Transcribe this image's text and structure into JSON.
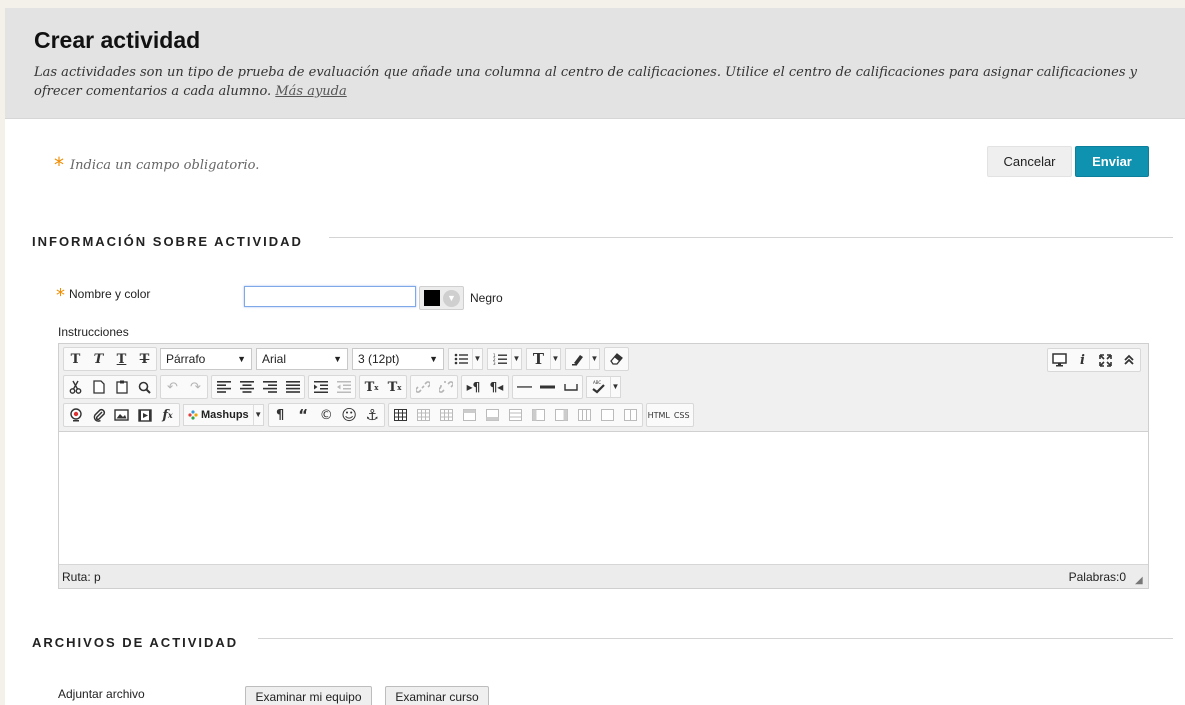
{
  "header": {
    "title": "Crear actividad",
    "description": "Las actividades son un tipo de prueba de evaluación que añade una columna al centro de calificaciones. Utilice el centro de calificaciones para asignar calificaciones y ofrecer comentarios a cada alumno.",
    "help_link": "Más ayuda"
  },
  "required_note": "Indica un campo obligatorio.",
  "required_mark": "*",
  "actions": {
    "cancel": "Cancelar",
    "submit": "Enviar"
  },
  "section_info": {
    "title": "INFORMACIÓN SOBRE ACTIVIDAD",
    "name_label": "Nombre y color",
    "name_value": "",
    "color_name": "Negro",
    "color_value": "#000000",
    "instructions_label": "Instrucciones"
  },
  "editor": {
    "paragraph_select": "Párrafo",
    "font_select": "Arial",
    "size_select": "3 (12pt)",
    "mashups_label": "Mashups",
    "html_label": "HTML",
    "css_label": "CSS",
    "path_text": "Ruta: p",
    "word_count": "Palabras:0"
  },
  "section_files": {
    "title": "ARCHIVOS DE ACTIVIDAD",
    "attach_label": "Adjuntar archivo",
    "browse_computer": "Examinar mi equipo",
    "browse_course": "Examinar curso"
  },
  "colors": {
    "accent": "#0f91b0",
    "required": "#f08c00",
    "header_bg": "#e3e3e3"
  }
}
